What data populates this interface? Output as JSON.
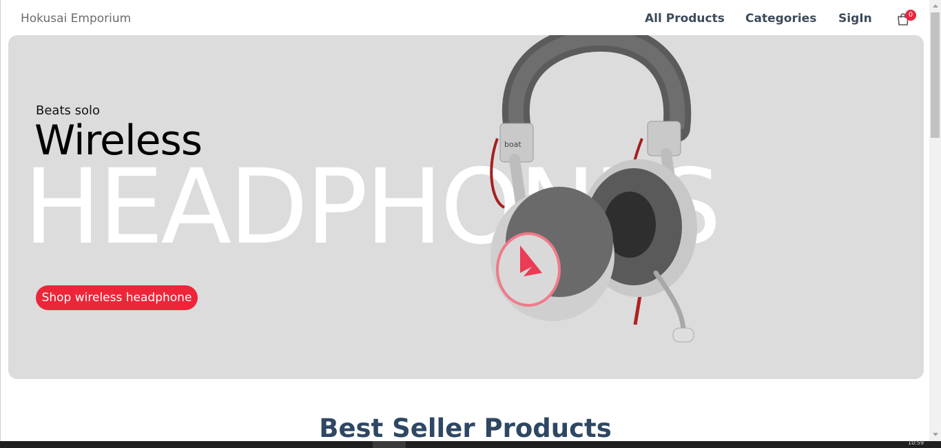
{
  "navbar": {
    "brand": "Hokusai Emporium",
    "links": [
      "All Products",
      "Categories",
      "SigIn"
    ],
    "cart_count": "0",
    "cart_icon": "shopping-bag-icon"
  },
  "hero": {
    "subtitle": "Beats solo",
    "title": "Wireless",
    "big_text": "HEADPHONES",
    "button_label": "Shop wireless headphone",
    "accent_color": "#ec2638",
    "background_color": "#dcdcdc",
    "image": "headphone-image"
  },
  "section": {
    "title": "Best Seller Products"
  },
  "taskbar": {
    "time": "10:59"
  }
}
